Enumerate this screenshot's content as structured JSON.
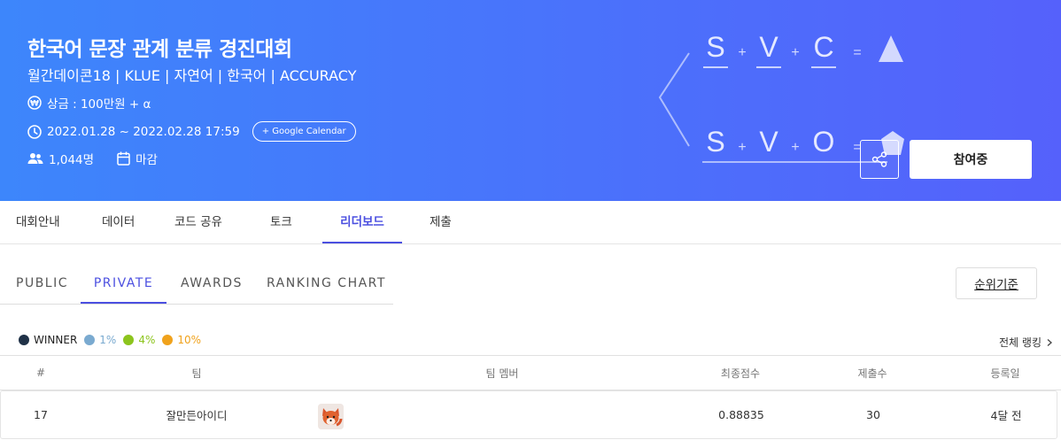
{
  "competition": {
    "title": "한국어 문장 관계 분류 경진대회",
    "subtitle": "월간데이콘18 | KLUE | 자연어 | 한국어 | ACCURACY",
    "prize": "상금 : 100만원 + α",
    "period": "2022.01.28 ~ 2022.02.28 17:59",
    "calendar_button": "+ Google Calendar",
    "participants": "1,044명",
    "status": "마감",
    "join_button": "참여중",
    "formula_top": [
      "S",
      "+",
      "V",
      "+",
      "C",
      "="
    ],
    "formula_bottom": [
      "S",
      "+",
      "V",
      "+",
      "O",
      "="
    ]
  },
  "main_tabs": [
    {
      "label": "대회안내",
      "active": false
    },
    {
      "label": "데이터",
      "active": false
    },
    {
      "label": "코드 공유",
      "active": false
    },
    {
      "label": "토크",
      "active": false
    },
    {
      "label": "리더보드",
      "active": true
    },
    {
      "label": "제출",
      "active": false
    }
  ],
  "sub_tabs": [
    {
      "label": "PUBLIC",
      "active": false
    },
    {
      "label": "PRIVATE",
      "active": true
    },
    {
      "label": "AWARDS",
      "active": false
    },
    {
      "label": "RANKING CHART",
      "active": false
    }
  ],
  "sort_button": "순위기준",
  "legend": [
    {
      "label": "WINNER",
      "color": "#1f3147"
    },
    {
      "label": "1%",
      "color": "#7aaad0"
    },
    {
      "label": "4%",
      "color": "#8cc41d"
    },
    {
      "label": "10%",
      "color": "#f0a21c"
    }
  ],
  "full_ranking_link": "전체 랭킹",
  "table": {
    "headers": {
      "rank": "#",
      "team": "팀",
      "members": "팀 멤버",
      "score": "최종점수",
      "submissions": "제출수",
      "registered": "등록일"
    },
    "rows": [
      {
        "rank": "17",
        "team": "잘만든아이디",
        "score": "0.88835",
        "submissions": "30",
        "registered": "4달 전"
      }
    ]
  }
}
